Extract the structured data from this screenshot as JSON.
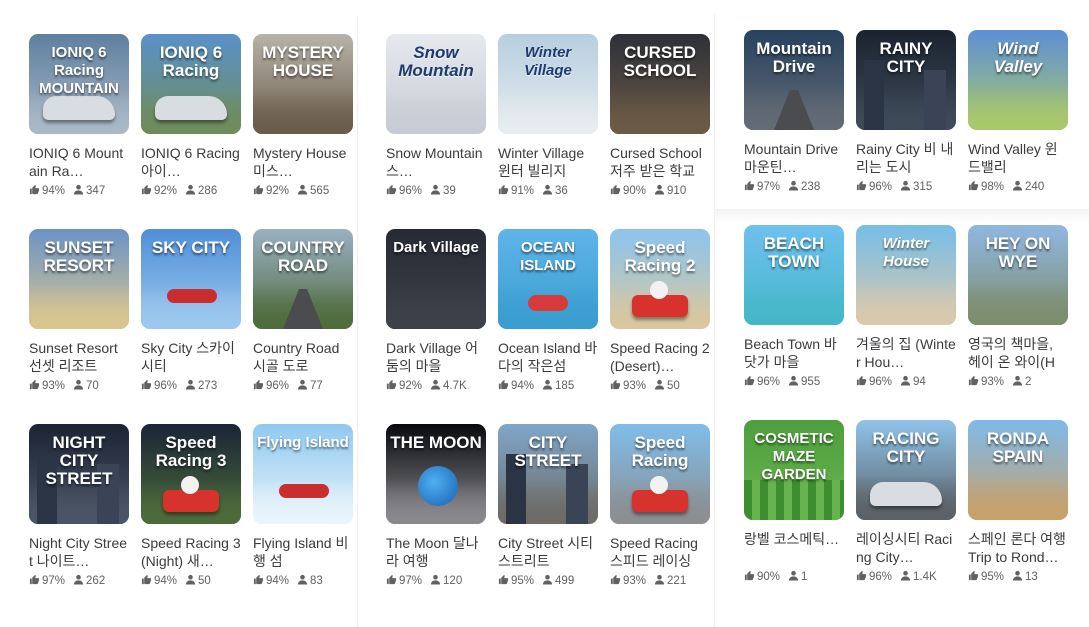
{
  "panels": [
    {
      "games": [
        {
          "thumb_title": "IONIQ 6 Racing\nMOUNTAIN",
          "name": "IONIQ 6 Mountain Ra…",
          "rating": "94%",
          "players": "347",
          "bg": [
            "#5f7fa0",
            "#a9b8c6"
          ],
          "style": "car"
        },
        {
          "thumb_title": "IONIQ 6\nRacing",
          "name": "IONIQ 6 Racing 아이…",
          "rating": "92%",
          "players": "286",
          "bg": [
            "#5a91c9",
            "#6f8c5c"
          ],
          "style": "car2"
        },
        {
          "thumb_title": "MYSTERY\nHOUSE",
          "name": "Mystery House 미스…",
          "rating": "92%",
          "players": "565",
          "bg": [
            "#b8b3a8",
            "#6b5d4c"
          ],
          "style": "stairs"
        },
        {
          "thumb_title": "SUNSET\nRESORT",
          "name": "Sunset Resort 선셋 리조트",
          "rating": "93%",
          "players": "70",
          "bg": [
            "#6c93c6",
            "#d8c68f"
          ],
          "style": "beach"
        },
        {
          "thumb_title": "SKY CITY",
          "name": "Sky City 스카이 시티",
          "rating": "96%",
          "players": "273",
          "bg": [
            "#4f8fd8",
            "#9cc8ef"
          ],
          "style": "skycity"
        },
        {
          "thumb_title": "COUNTRY\nROAD",
          "name": "Country Road 시골 도로",
          "rating": "96%",
          "players": "77",
          "bg": [
            "#9ab0c4",
            "#4f6c3d"
          ],
          "style": "road"
        },
        {
          "thumb_title": "NIGHT CITY\nSTREET",
          "name": "Night City Street 나이트…",
          "rating": "97%",
          "players": "262",
          "bg": [
            "#1c2434",
            "#4b5566"
          ],
          "style": "night"
        },
        {
          "thumb_title": "Speed\nRacing 3",
          "name": "Speed Racing 3 (Night) 새…",
          "rating": "94%",
          "players": "50",
          "bg": [
            "#1a2438",
            "#4d6b3a"
          ],
          "style": "kart"
        },
        {
          "thumb_title": "Flying Island",
          "name": "Flying Island 비행 섬",
          "rating": "94%",
          "players": "83",
          "bg": [
            "#8fc9f0",
            "#e9f4fb"
          ],
          "style": "island"
        }
      ]
    },
    {
      "games": [
        {
          "thumb_title": "Snow\nMountain",
          "name": "Snow Mountain 스…",
          "rating": "96%",
          "players": "39",
          "bg": [
            "#e6e9ee",
            "#c7ccd4"
          ],
          "style": "snow"
        },
        {
          "thumb_title": "Winter Village",
          "name": "Winter Village 윈터 빌리지",
          "rating": "91%",
          "players": "36",
          "bg": [
            "#b7cee0",
            "#e6ecef"
          ],
          "style": "village"
        },
        {
          "thumb_title": "CURSED\nSCHOOL",
          "name": "Cursed School 저주 받은 학교",
          "rating": "90%",
          "players": "910",
          "bg": [
            "#2d3038",
            "#6b5a46"
          ],
          "style": "school"
        },
        {
          "thumb_title": "Dark Village",
          "name": "Dark Village 어둠의 마을",
          "rating": "92%",
          "players": "4.7K",
          "bg": [
            "#262a33",
            "#3d4149"
          ],
          "style": "dark"
        },
        {
          "thumb_title": "OCEAN ISLAND",
          "name": "Ocean Island 바다의 작은섬",
          "rating": "94%",
          "players": "185",
          "bg": [
            "#5fb4e8",
            "#3a9ed0"
          ],
          "style": "ocean"
        },
        {
          "thumb_title": "Speed\nRacing 2",
          "name": "Speed Racing 2 (Desert)…",
          "rating": "93%",
          "players": "50",
          "bg": [
            "#8cc4ee",
            "#d8c7a0"
          ],
          "style": "kart2"
        },
        {
          "thumb_title": "THE MOON",
          "name": "The Moon 달나라 여행",
          "rating": "97%",
          "players": "120",
          "bg": [
            "#08090d",
            "#8a8a8e"
          ],
          "style": "moon"
        },
        {
          "thumb_title": "CITY\nSTREET",
          "name": "City Street 시티 스트리트",
          "rating": "95%",
          "players": "499",
          "bg": [
            "#7fa6c9",
            "#6e6b67"
          ],
          "style": "city"
        },
        {
          "thumb_title": "Speed\nRacing",
          "name": "Speed Racing 스피드 레이싱",
          "rating": "93%",
          "players": "221",
          "bg": [
            "#80bdea",
            "#8c8e91"
          ],
          "style": "kart3"
        }
      ]
    },
    {
      "games": [
        {
          "thumb_title": "Mountain\nDrive",
          "name": "Mountain Drive 마운틴…",
          "rating": "97%",
          "players": "238",
          "bg": [
            "#27415e",
            "#636b75"
          ],
          "style": "mdrive"
        },
        {
          "thumb_title": "RAINY CITY",
          "name": "Rainy City 비 내리는 도시",
          "rating": "96%",
          "players": "315",
          "bg": [
            "#1b2330",
            "#3e4a58"
          ],
          "style": "rainy"
        },
        {
          "thumb_title": "Wind\nValley",
          "name": "Wind Valley 윈드밸리",
          "rating": "98%",
          "players": "240",
          "bg": [
            "#5d8fd6",
            "#a9c86b"
          ],
          "style": "wind"
        },
        {
          "thumb_title": "BEACH TOWN",
          "name": "Beach Town 바닷가 마을",
          "rating": "96%",
          "players": "955",
          "bg": [
            "#6fc0ee",
            "#46b7c9"
          ],
          "style": "beachtown"
        },
        {
          "thumb_title": "Winter House",
          "name": "겨울의 집 (Winter Hou…",
          "rating": "96%",
          "players": "94",
          "bg": [
            "#76bde8",
            "#d9c9ad"
          ],
          "style": "winterhouse"
        },
        {
          "thumb_title": "HEY ON WYE",
          "name": "영국의 책마을, 헤이 온 와이(Ha…",
          "rating": "93%",
          "players": "2",
          "bg": [
            "#8fb7e2",
            "#7e8d6e"
          ],
          "style": "hey"
        },
        {
          "thumb_title": "COSMETIC\nMAZE GARDEN",
          "name": "랑벨 코스메틱…",
          "rating": "90%",
          "players": "1",
          "bg": [
            "#4d9e3e",
            "#6bb64f"
          ],
          "style": "maze"
        },
        {
          "thumb_title": "RACING CITY",
          "name": "레이싱시티 Racing City…",
          "rating": "96%",
          "players": "1.4K",
          "bg": [
            "#8fc3ea",
            "#5b6166"
          ],
          "style": "racingcity"
        },
        {
          "thumb_title": "RONDA\nSPAIN",
          "name": "스페인 론다 여행 Trip to Rond…",
          "rating": "95%",
          "players": "13",
          "bg": [
            "#7fb9ea",
            "#c7a16c"
          ],
          "style": "ronda"
        }
      ]
    }
  ],
  "icons": {
    "rating": "thumbs-up-icon",
    "players": "person-icon"
  },
  "text_color": "#393b3d",
  "meta_color": "#606162"
}
